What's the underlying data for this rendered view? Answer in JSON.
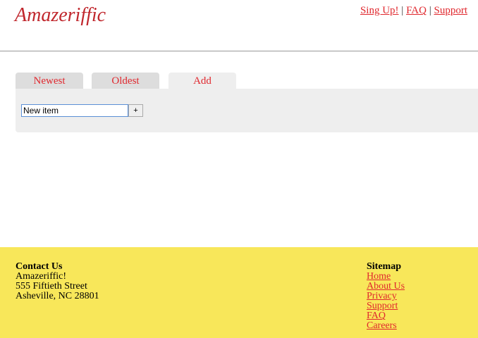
{
  "header": {
    "logo": "Amazeriffic",
    "nav": [
      "Sing Up!",
      "FAQ",
      "Support"
    ],
    "separator": "|"
  },
  "tabs": [
    {
      "label": "Newest",
      "active": false
    },
    {
      "label": "Oldest",
      "active": false
    },
    {
      "label": "Add",
      "active": true
    }
  ],
  "add_panel": {
    "input_value": "New item",
    "button_label": "+"
  },
  "footer": {
    "contact": {
      "heading": "Contact Us",
      "lines": [
        "Amazeriffic!",
        "555 Fiftieth Street",
        "Asheville, NC 28801"
      ]
    },
    "sitemap": {
      "heading": "Sitemap",
      "links": [
        "Home",
        "About Us",
        "Privacy",
        "Support",
        "FAQ",
        "Careers"
      ]
    }
  },
  "colors": {
    "accent": "#e0282e",
    "logo": "#c0272d",
    "footer_bg": "#f8e75a",
    "tab_bg": "#dddddd",
    "panel_bg": "#eeeeee"
  }
}
